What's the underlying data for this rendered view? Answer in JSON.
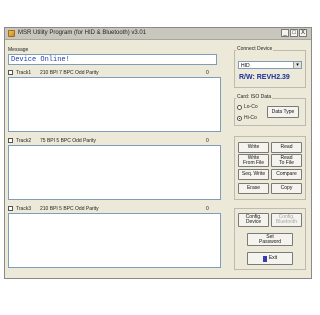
{
  "window": {
    "title": "MSR Utility Program (for HID & Bluetooth) v3.01",
    "minimize": "_",
    "maximize": "□",
    "close": "X"
  },
  "message": {
    "label": "Message",
    "value": "Device Online!"
  },
  "tracks": [
    {
      "label": "Track1",
      "info": "210 BPI  7 BPC  Odd Parity",
      "count": "0"
    },
    {
      "label": "Track2",
      "info": "75 BPI  5 BPC  Odd Parity",
      "count": "0"
    },
    {
      "label": "Track3",
      "info": "210 BPI  5 BPC  Odd Parity",
      "count": "0"
    }
  ],
  "connected_device": {
    "label": "Connect Device",
    "selected": "HID",
    "rw_version": "R/W: REVH2.39"
  },
  "card": {
    "label": "Card: ISO Data",
    "options": [
      "Lo-Co",
      "Hi-Co"
    ],
    "selected": "Hi-Co",
    "data_type_button": "Data Type"
  },
  "actions": {
    "write": "Write",
    "read": "Read",
    "write_from_file_1": "Write",
    "write_from_file_2": "From File",
    "read_to_file_1": "Read",
    "read_to_file_2": "To File",
    "seq_write": "Seq. Write",
    "compare": "Compare",
    "erase": "Erase",
    "copy": "Copy"
  },
  "config": {
    "config_device_1": "Config.",
    "config_device_2": "Device",
    "config_bluetooth_1": "Config.",
    "config_bluetooth_2": "Bluetooth",
    "set_password_1": "Set",
    "set_password_2": "Password",
    "exit": "Exit"
  },
  "icons": {
    "app": "app-icon",
    "exit": "exit-door-icon"
  }
}
